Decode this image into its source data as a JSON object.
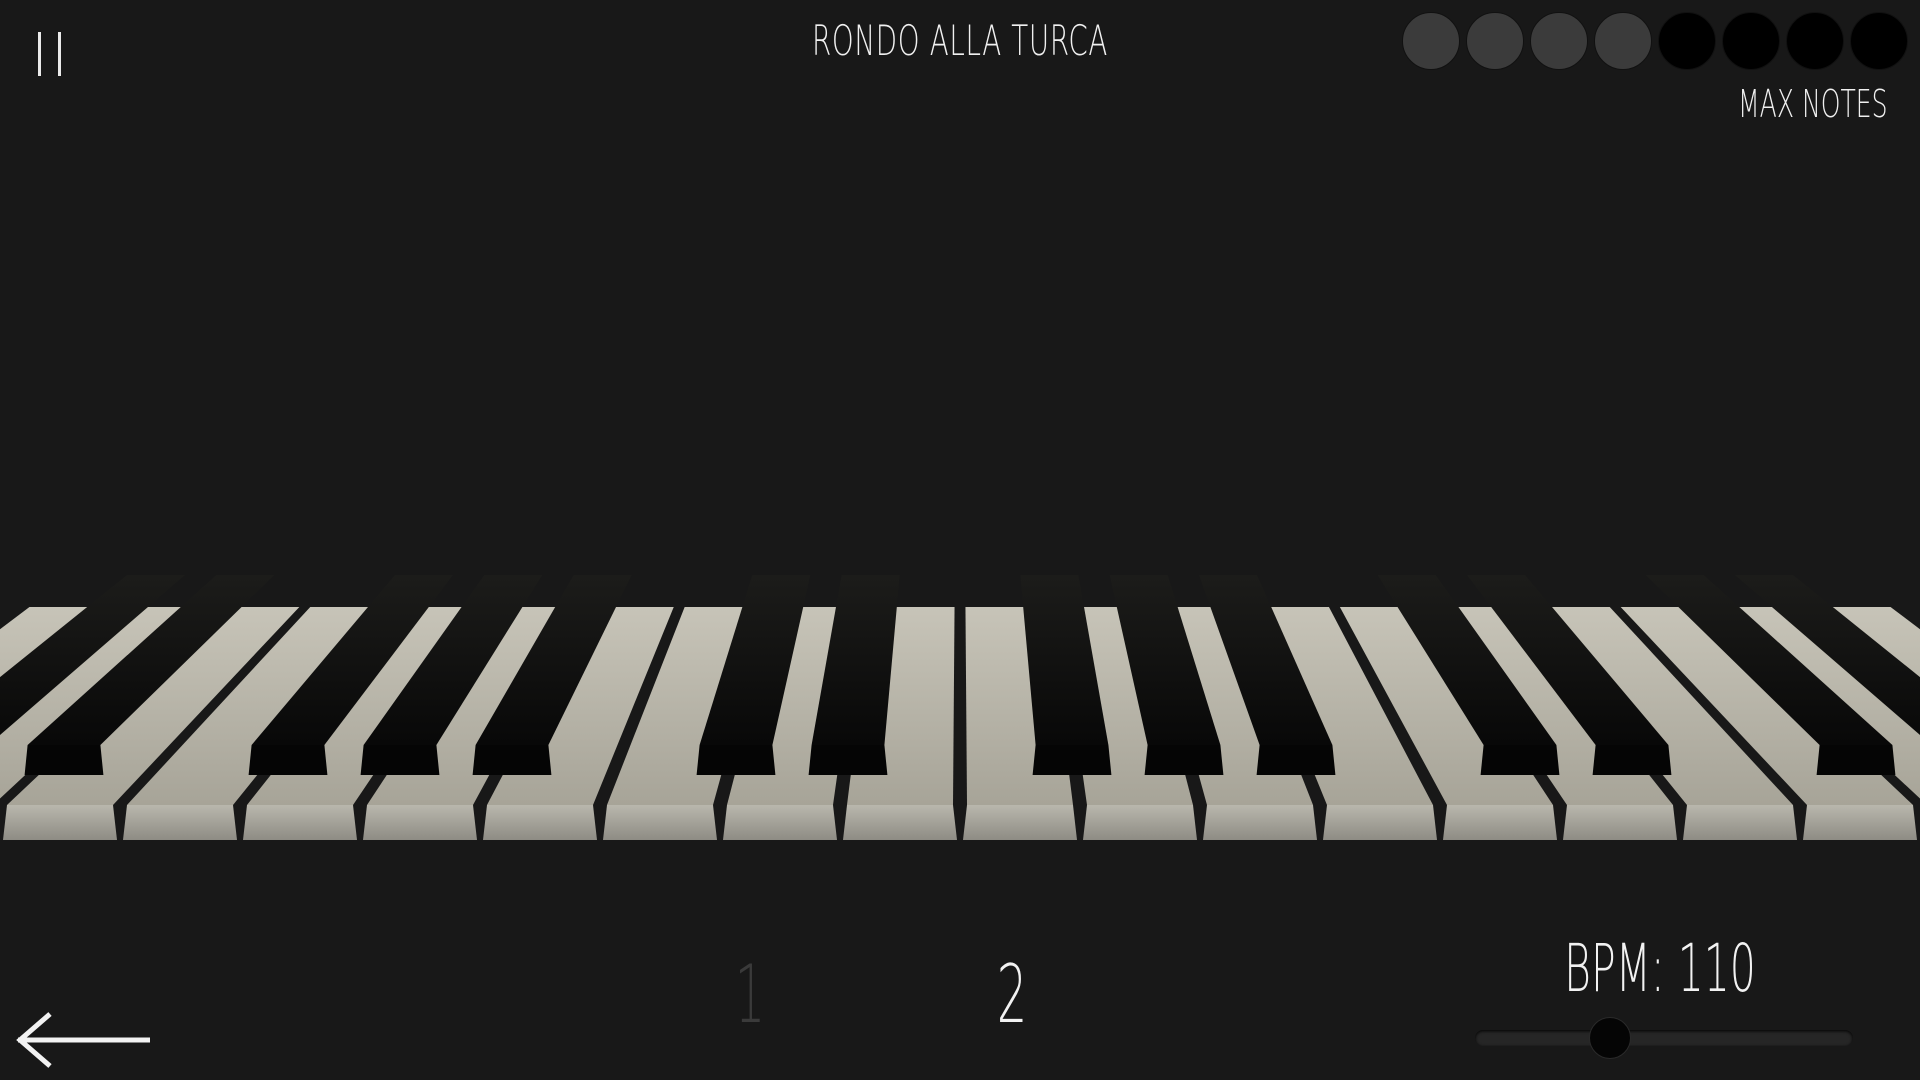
{
  "song": {
    "title": "RONDO ALLA TURCA"
  },
  "max_notes": {
    "label": "MAX NOTES",
    "total": 8,
    "active": 4,
    "active_color": "#3b3b3b",
    "inactive_color": "#000000"
  },
  "pager": {
    "pages": [
      "1",
      "2"
    ],
    "current": "2"
  },
  "bpm": {
    "label": "BPM: 110",
    "min": 60,
    "max": 200,
    "value": 110
  },
  "icons": {
    "pause": "pause-icon",
    "back": "back-arrow-icon"
  },
  "colors": {
    "background": "#181818",
    "white_key": "#b5b2a6",
    "black_key": "#0c0c0c"
  }
}
